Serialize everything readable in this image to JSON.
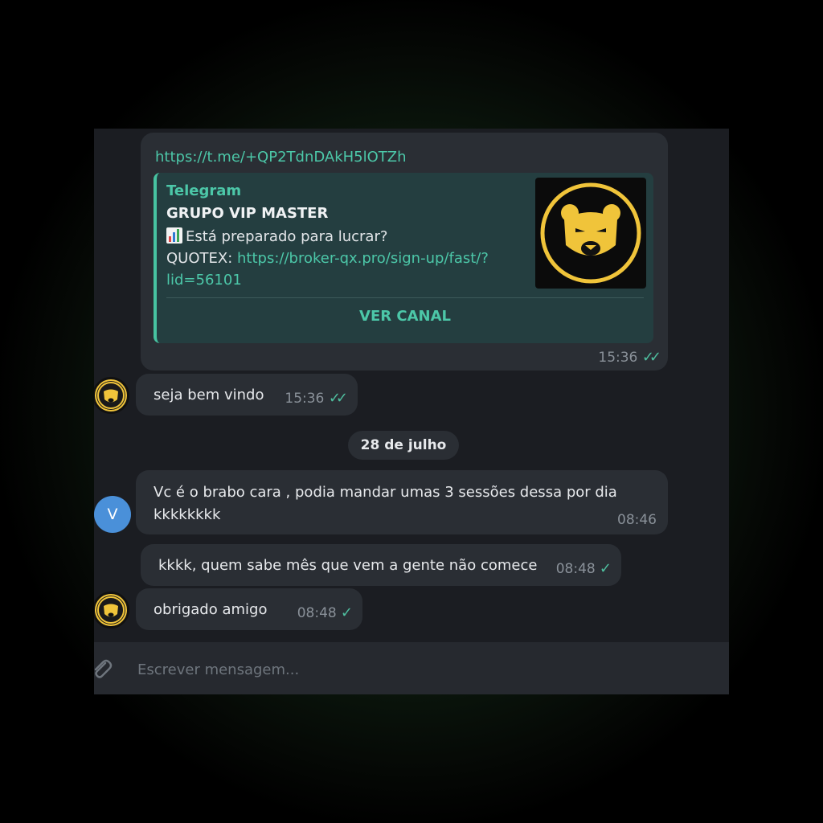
{
  "messages": {
    "link_post": {
      "url": "https://t.me/+QP2TdnDAkH5lOTZh",
      "preview": {
        "site": "Telegram",
        "title": "GRUPO VIP MASTER",
        "desc_line1": "Está preparado para lucrar?",
        "desc_label": "QUOTEX: ",
        "desc_link": "https://broker-qx.pro/sign-up/fast/?lid=56101",
        "button": "VER CANAL",
        "image_icon": "bear-logo-icon"
      },
      "time": "15:36",
      "status": "read"
    },
    "welcome": {
      "text": "seja bem vindo",
      "time": "15:36",
      "status": "read"
    },
    "date_separator": "28 de julho",
    "incoming": {
      "avatar_letter": "V",
      "line1": "Vc é o brabo cara , podia mandar umas 3 sessões dessa por dia",
      "line2": "kkkkkkkk",
      "time": "08:46"
    },
    "reply1": {
      "text": "kkkk, quem sabe mês que vem a gente não comece",
      "time": "08:48",
      "status": "sent"
    },
    "reply2": {
      "text": "obrigado amigo",
      "time": "08:48",
      "status": "sent"
    }
  },
  "composer": {
    "placeholder": "Escrever mensagem...",
    "attach_icon": "paperclip-icon"
  },
  "colors": {
    "accent": "#4cc7a8",
    "bubble": "#2a2e34",
    "chat_bg": "#1b1d22",
    "bear_gold": "#f0c43a"
  }
}
